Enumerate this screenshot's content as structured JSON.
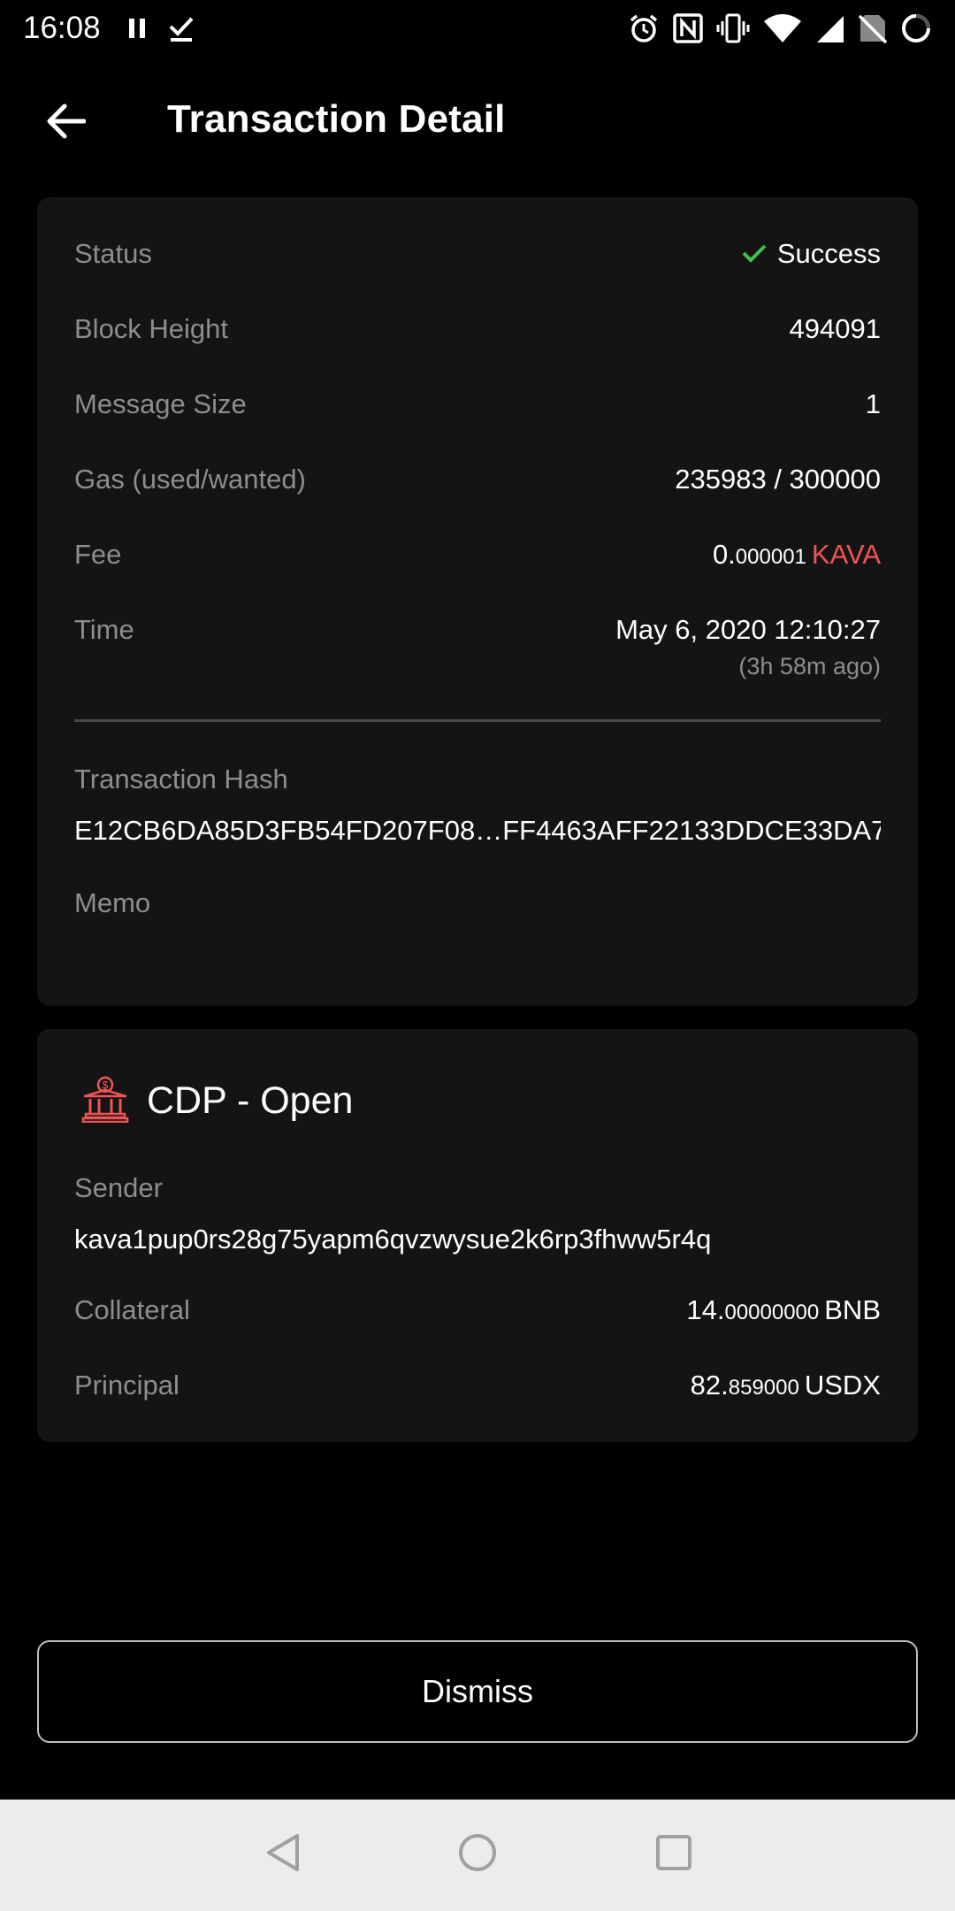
{
  "status_bar": {
    "time": "16:08",
    "icons": [
      "pause-icon",
      "download-done-icon",
      "alarm-icon",
      "nfc-icon",
      "vibrate-icon",
      "wifi-icon",
      "signal-icon",
      "no-sim-icon",
      "battery-icon"
    ]
  },
  "app_bar": {
    "title": "Transaction Detail",
    "back_icon": "arrow-left-icon"
  },
  "details": {
    "status_label": "Status",
    "status_value": "Success",
    "block_height_label": "Block Height",
    "block_height_value": "494091",
    "message_size_label": "Message Size",
    "message_size_value": "1",
    "gas_label": "Gas (used/wanted)",
    "gas_value": "235983 / 300000",
    "fee_label": "Fee",
    "fee_int": "0.",
    "fee_dec": "000001",
    "fee_unit": "KAVA",
    "time_label": "Time",
    "time_value": "May 6, 2020 12:10:27",
    "time_ago": "(3h 58m ago)",
    "hash_label": "Transaction Hash",
    "hash_value": "E12CB6DA85D3FB54FD207F08…FF4463AFF22133DDCE33DA7",
    "memo_label": "Memo",
    "memo_value": ""
  },
  "message": {
    "title": "CDP - Open",
    "icon": "bank-icon",
    "sender_label": "Sender",
    "sender_value": "kava1pup0rs28g75yapm6qvzwysue2k6rp3fhww5r4q",
    "collateral_label": "Collateral",
    "collateral_int": "14.",
    "collateral_dec": "00000000",
    "collateral_unit": "BNB",
    "principal_label": "Principal",
    "principal_int": "82.",
    "principal_dec": "859000",
    "principal_unit": "USDX"
  },
  "dismiss_label": "Dismiss",
  "colors": {
    "background": "#000000",
    "card": "#141414",
    "label": "#8d8d92",
    "success": "#3fbf4f",
    "kava": "#f05454"
  },
  "nav_bar": {
    "icons": [
      "back-triangle-icon",
      "home-circle-icon",
      "recents-square-icon"
    ]
  }
}
